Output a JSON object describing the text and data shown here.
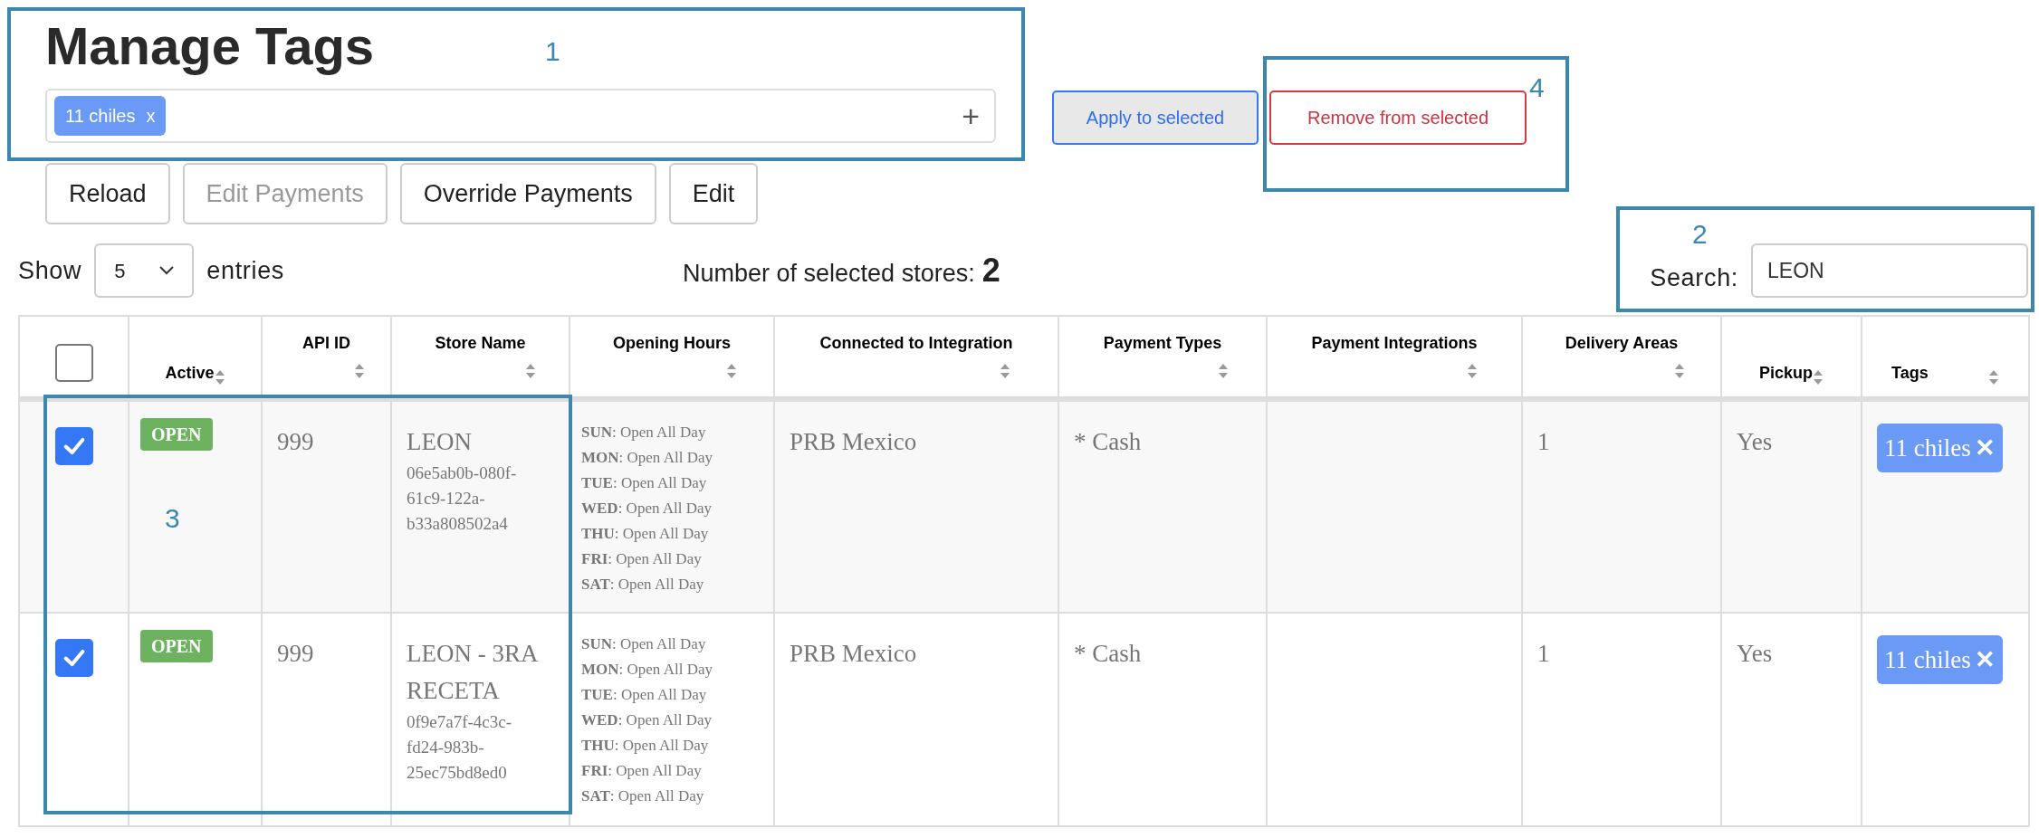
{
  "title": "Manage Tags",
  "tag_input": {
    "tags": [
      {
        "label": "11 chiles",
        "remove": "x"
      }
    ],
    "add": "+"
  },
  "bulk_actions": [
    {
      "label": "Apply to selected",
      "kind": "apply"
    },
    {
      "label": "Remove from selected",
      "kind": "remove"
    }
  ],
  "buttons": [
    {
      "label": "Reload",
      "disabled": false
    },
    {
      "label": "Edit Payments",
      "disabled": true
    },
    {
      "label": "Override Payments",
      "disabled": false
    },
    {
      "label": "Edit",
      "disabled": false
    }
  ],
  "entries": {
    "before": "Show",
    "value": "5",
    "after": "entries"
  },
  "selected_count": {
    "label": "Number of selected stores:",
    "value": "2"
  },
  "search": {
    "label": "Search:",
    "value": "LEON"
  },
  "table": {
    "select_all": {
      "checked": false
    },
    "columns": [
      {
        "label": "Active",
        "kind": "inline"
      },
      {
        "label": "API ID",
        "kind": "stacked"
      },
      {
        "label": "Store Name",
        "kind": "stacked"
      },
      {
        "label": "Opening Hours",
        "kind": "stacked"
      },
      {
        "label": "Connected to Integration",
        "kind": "stacked"
      },
      {
        "label": "Payment Types",
        "kind": "stacked"
      },
      {
        "label": "Payment Integrations",
        "kind": "stacked"
      },
      {
        "label": "Delivery Areas",
        "kind": "stacked"
      },
      {
        "label": "Pickup",
        "kind": "inline"
      },
      {
        "label": "Tags",
        "kind": "spread"
      }
    ],
    "rows": [
      {
        "selected": true,
        "status": "OPEN",
        "api_id": "999",
        "store_name": "LEON",
        "uuid": "06e5ab0b-080f-61c9-122a-b33a808502a4",
        "hours": [
          {
            "day": "SUN",
            "text": ": Open All Day"
          },
          {
            "day": "MON",
            "text": ": Open All Day"
          },
          {
            "day": "TUE",
            "text": ": Open All Day"
          },
          {
            "day": "WED",
            "text": ": Open All Day"
          },
          {
            "day": "THU",
            "text": ": Open All Day"
          },
          {
            "day": "FRI",
            "text": ": Open All Day"
          },
          {
            "day": "SAT",
            "text": ": Open All Day"
          }
        ],
        "integration": "PRB Mexico",
        "payment_types": "* Cash",
        "delivery_areas": "1",
        "pickup": "Yes",
        "tags": [
          {
            "label": "11 chiles",
            "remove": "✕"
          }
        ]
      },
      {
        "selected": true,
        "status": "OPEN",
        "api_id": "999",
        "store_name": "LEON - 3RA RECETA",
        "uuid": "0f9e7a7f-4c3c-fd24-983b-25ec75bd8ed0",
        "hours": [
          {
            "day": "SUN",
            "text": ": Open All Day"
          },
          {
            "day": "MON",
            "text": ": Open All Day"
          },
          {
            "day": "TUE",
            "text": ": Open All Day"
          },
          {
            "day": "WED",
            "text": ": Open All Day"
          },
          {
            "day": "THU",
            "text": ": Open All Day"
          },
          {
            "day": "FRI",
            "text": ": Open All Day"
          },
          {
            "day": "SAT",
            "text": ": Open All Day"
          }
        ],
        "integration": "PRB Mexico",
        "payment_types": "* Cash",
        "delivery_areas": "1",
        "pickup": "Yes",
        "tags": [
          {
            "label": "11 chiles",
            "remove": "✕"
          }
        ]
      }
    ]
  },
  "annotations": [
    {
      "label": "1"
    },
    {
      "label": "4"
    },
    {
      "label": "2"
    },
    {
      "label": "3"
    }
  ]
}
